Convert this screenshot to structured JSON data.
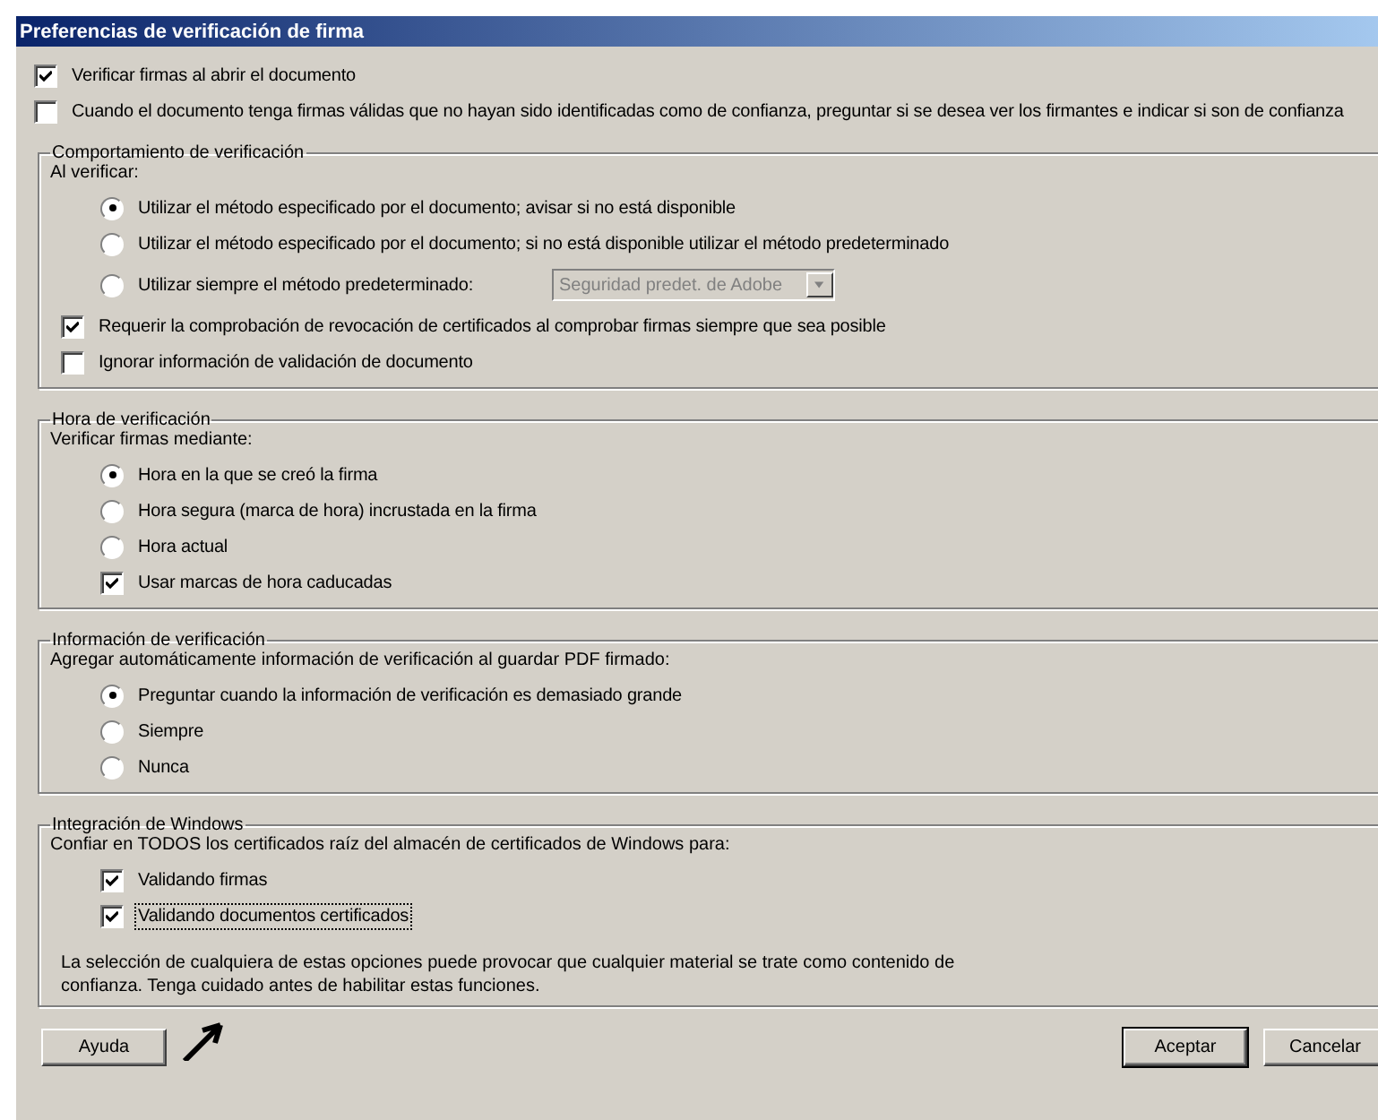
{
  "window": {
    "title": "Preferencias de verificación de firma"
  },
  "options": [
    {
      "label": "Verificar firmas al abrir el documento",
      "checked": true
    },
    {
      "label": "Cuando el documento tenga firmas válidas que no hayan sido identificadas como de confianza, preguntar si se desea ver los firmantes e indicar si son de confianza",
      "checked": false
    }
  ],
  "groups": [
    {
      "title": "Comportamiento de verificación",
      "prompt": "Al verificar:",
      "items": [
        {
          "kind": "radio",
          "label": "Utilizar el método especificado por el documento; avisar si no está disponible",
          "selected": true
        },
        {
          "kind": "radio",
          "label": "Utilizar el método especificado por el documento; si no está disponible utilizar el método predeterminado",
          "selected": false
        },
        {
          "kind": "radio-select",
          "label": "Utilizar siempre el método predeterminado:",
          "selected": false,
          "select": {
            "value": "Seguridad predet. de Adobe",
            "disabled": true
          }
        },
        {
          "kind": "setting",
          "label": "Requerir la comprobación de revocación de certificados al comprobar firmas siempre que sea posible",
          "checked": true
        },
        {
          "kind": "setting",
          "label": "Ignorar información de validación de documento",
          "checked": false
        }
      ]
    },
    {
      "title": "Hora de verificación",
      "prompt": "Verificar firmas mediante:",
      "items": [
        {
          "kind": "radio",
          "label": "Hora en la que se creó la firma",
          "selected": true
        },
        {
          "kind": "radio",
          "label": "Hora segura (marca de hora) incrustada en la firma",
          "selected": false
        },
        {
          "kind": "radio",
          "label": "Hora actual",
          "selected": false
        },
        {
          "kind": "checkbox",
          "label": "Usar marcas de hora caducadas",
          "checked": true
        }
      ]
    },
    {
      "title": "Información de verificación",
      "prompt": "Agregar automáticamente información de verificación al guardar PDF firmado:",
      "items": [
        {
          "kind": "radio",
          "label": "Preguntar cuando la información de verificación es demasiado grande",
          "selected": true
        },
        {
          "kind": "radio",
          "label": "Siempre",
          "selected": false
        },
        {
          "kind": "radio",
          "label": "Nunca",
          "selected": false
        }
      ]
    },
    {
      "title": "Integración de Windows",
      "prompt": "Confiar en TODOS los certificados raíz del almacén de certificados de Windows para:",
      "items": [
        {
          "kind": "checkbox",
          "label": "Validando firmas",
          "checked": true
        },
        {
          "kind": "checkbox",
          "label": "Validando documentos certificados",
          "checked": true,
          "focused": true
        }
      ],
      "note": "La selección de cualquiera de estas opciones puede provocar que cualquier material se trate como contenido de confianza. Tenga cuidado antes de habilitar estas funciones."
    }
  ],
  "buttons": {
    "help": "Ayuda",
    "ok": "Aceptar",
    "cancel": "Cancelar"
  }
}
